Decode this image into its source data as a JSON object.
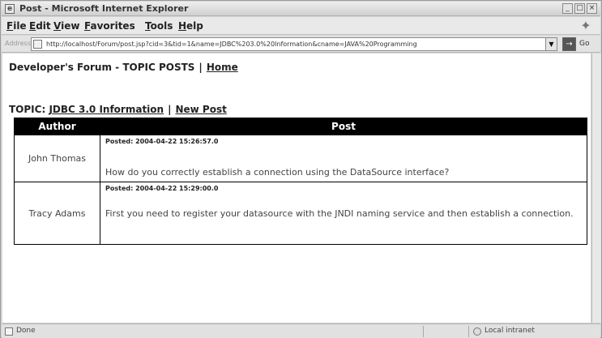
{
  "window": {
    "title": "Post - Microsoft Internet Explorer",
    "controls": [
      "_",
      "□",
      "×"
    ]
  },
  "menubar": {
    "items": [
      "File",
      "Edit",
      "View",
      "Favorites",
      "Tools",
      "Help"
    ]
  },
  "addressbar": {
    "label": "Address",
    "url": "http://localhost/Forum/post.jsp?cid=3&tid=1&name=JDBC%203.0%20Information&cname=JAVA%20Programming",
    "go_label": "Go"
  },
  "page": {
    "heading": "Developer's Forum - TOPIC POSTS",
    "separator": "|",
    "home_link": "Home",
    "topic_prefix": "TOPIC:",
    "topic_link": "JDBC 3.0 Information",
    "new_post_link": "New Post"
  },
  "posts_table": {
    "headers": [
      "Author",
      "Post"
    ],
    "rows": [
      {
        "author": "John Thomas",
        "posted": "Posted: 2004-04-22 15:26:57.0",
        "body": "How do you correctly establish a connection using the DataSource interface?"
      },
      {
        "author": "Tracy Adams",
        "posted": "Posted: 2004-04-22 15:29:00.0",
        "body": "First you need to register your datasource with the JNDI naming service and then establish a connection."
      }
    ]
  },
  "statusbar": {
    "status": "Done",
    "zone": "Local intranet"
  }
}
